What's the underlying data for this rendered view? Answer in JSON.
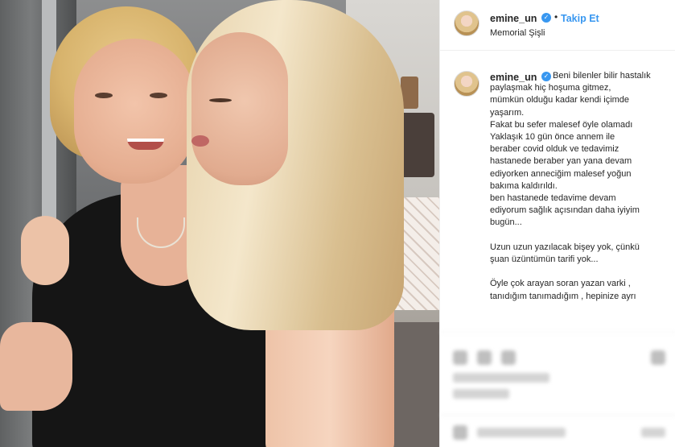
{
  "post": {
    "header": {
      "username": "emine_un",
      "verified": "✓",
      "separator": "•",
      "follow_label": "Takip Et",
      "location": "Memorial Şişli"
    },
    "caption": {
      "username": "emine_un",
      "verified": "✓",
      "lines": [
        "Beni bilenler bilir hastalık",
        "paylaşmak hiç hoşuma gitmez,",
        "mümkün olduğu kadar kendi içimde",
        "yaşarım.",
        "Fakat bu sefer malesef öyle olamadı",
        "Yaklaşık 10 gün önce annem ile",
        "beraber covid olduk ve tedavimiz",
        "hastanede beraber yan yana devam",
        "ediyorken anneciğim malesef yoğun",
        "bakıma kaldırıldı.",
        "ben hastanede tedavime devam",
        "ediyorum sağlık açısından daha iyiyim",
        "bugün...",
        "",
        "Uzun uzun yazılacak bişey yok, çünkü",
        "şuan üzüntümün tarifi yok...",
        "",
        "Öyle çok arayan soran yazan varki ,",
        "tanıdığım tanımadığım , hepinize ayrı"
      ]
    }
  },
  "colors": {
    "accent": "#3897f0",
    "text": "#262626",
    "border": "#efefef"
  },
  "icons": [
    "verified-badge-icon",
    "like-icon",
    "comment-icon",
    "share-icon",
    "save-icon"
  ]
}
